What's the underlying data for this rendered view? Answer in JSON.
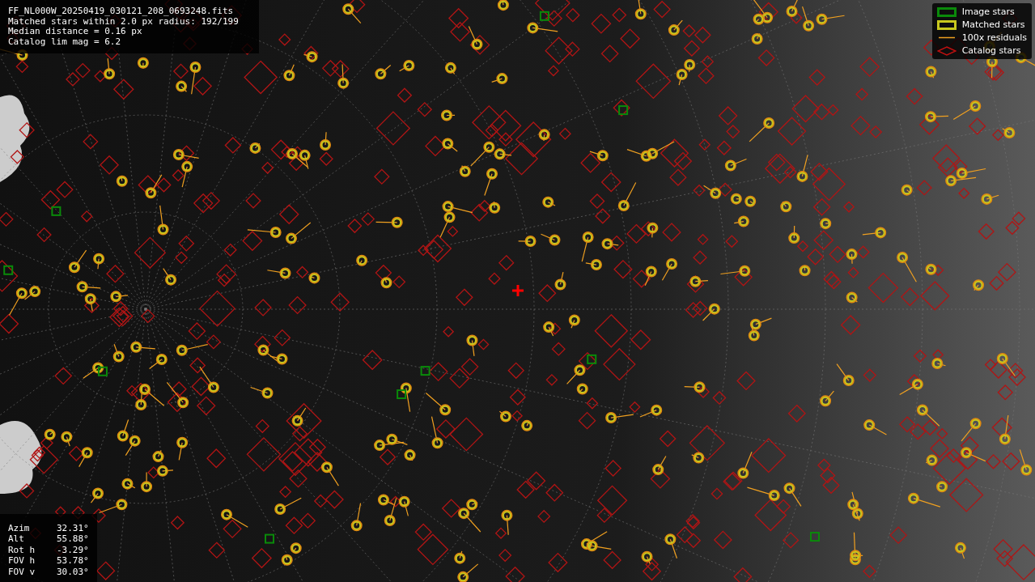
{
  "header": {
    "lines": [
      "FF_NL000W_20250419_030121_208_0693248.fits",
      "Matched stars within 2.0 px radius: 192/199",
      "Median distance = 0.16 px",
      "Catalog lim mag = 6.2"
    ]
  },
  "legend": [
    {
      "label": "Image stars",
      "kind": "box",
      "color": "#0a8a0a"
    },
    {
      "label": "Matched stars",
      "kind": "box",
      "color": "#c8c81e"
    },
    {
      "label": "100x residuals",
      "kind": "line",
      "color": "#f0a020"
    },
    {
      "label": "Catalog stars",
      "kind": "diamond",
      "color": "#c01010"
    }
  ],
  "pointing": [
    {
      "label": "Azim",
      "value": "32.31°"
    },
    {
      "label": "Alt",
      "value": "55.88°"
    },
    {
      "label": "Rot h",
      "value": "-3.29°"
    },
    {
      "label": "FOV h",
      "value": "53.78°"
    },
    {
      "label": "FOV v",
      "value": "30.03°"
    }
  ]
}
